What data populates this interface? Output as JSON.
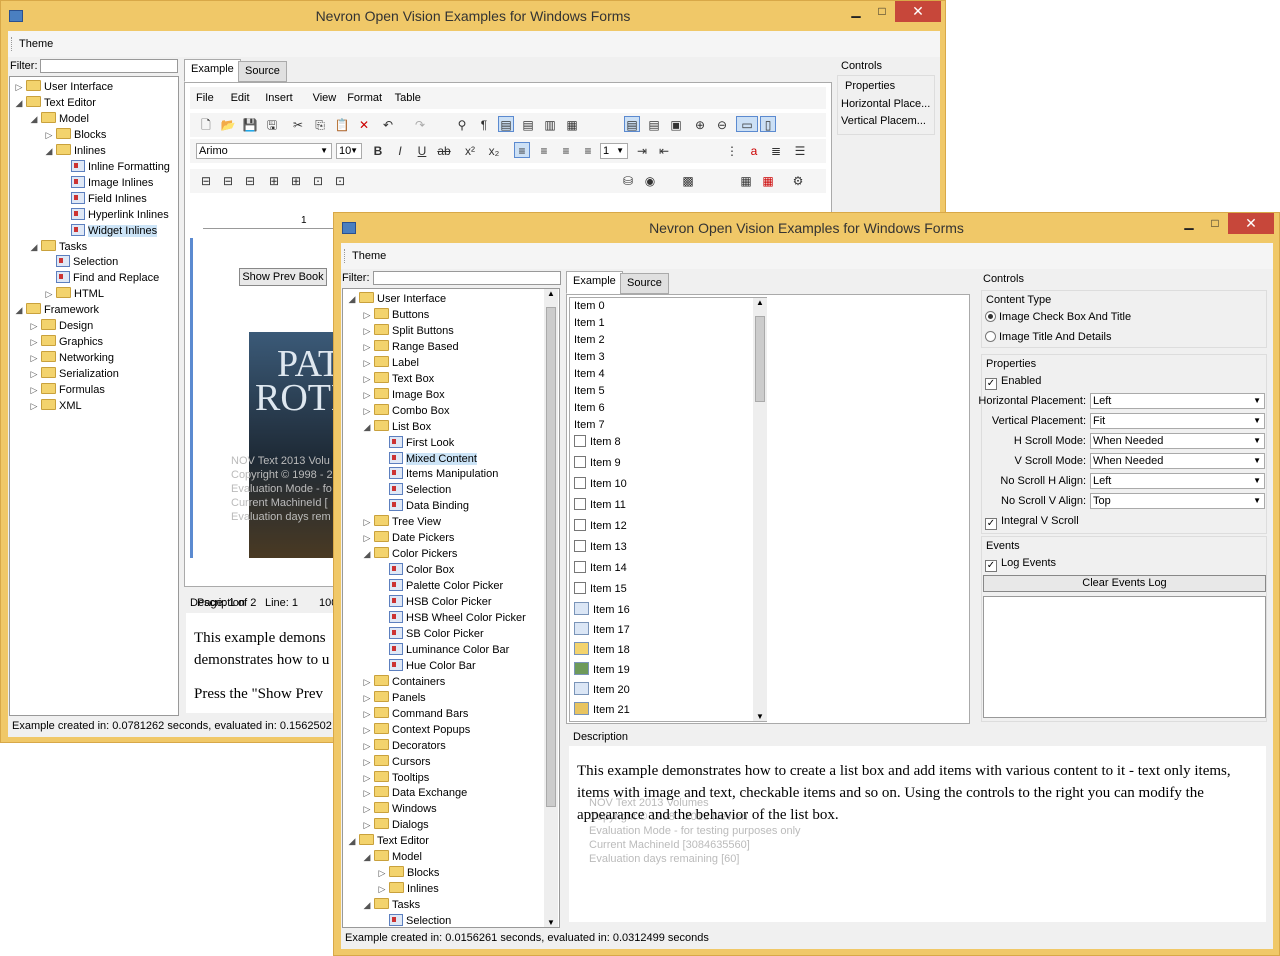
{
  "back": {
    "title": "Nevron Open Vision Examples for Windows Forms",
    "menu": "Theme",
    "filter_label": "Filter:",
    "tree": [
      {
        "t": "User Interface",
        "lvl": 0,
        "tog": "▷",
        "k": "f"
      },
      {
        "t": "Text Editor",
        "lvl": 0,
        "tog": "◢",
        "k": "f"
      },
      {
        "t": "Model",
        "lvl": 1,
        "tog": "◢",
        "k": "f"
      },
      {
        "t": "Blocks",
        "lvl": 2,
        "tog": "▷",
        "k": "f"
      },
      {
        "t": "Inlines",
        "lvl": 2,
        "tog": "◢",
        "k": "f"
      },
      {
        "t": "Inline Formatting",
        "lvl": 3,
        "tog": "",
        "k": "d"
      },
      {
        "t": "Image Inlines",
        "lvl": 3,
        "tog": "",
        "k": "d"
      },
      {
        "t": "Field Inlines",
        "lvl": 3,
        "tog": "",
        "k": "d"
      },
      {
        "t": "Hyperlink Inlines",
        "lvl": 3,
        "tog": "",
        "k": "d"
      },
      {
        "t": "Widget Inlines",
        "lvl": 3,
        "tog": "",
        "k": "d",
        "sel": true
      },
      {
        "t": "Tasks",
        "lvl": 1,
        "tog": "◢",
        "k": "f"
      },
      {
        "t": "Selection",
        "lvl": 2,
        "tog": "",
        "k": "d"
      },
      {
        "t": "Find and Replace",
        "lvl": 2,
        "tog": "",
        "k": "d"
      },
      {
        "t": "HTML",
        "lvl": 2,
        "tog": "▷",
        "k": "f"
      },
      {
        "t": "Framework",
        "lvl": 0,
        "tog": "◢",
        "k": "f"
      },
      {
        "t": "Design",
        "lvl": 1,
        "tog": "▷",
        "k": "f"
      },
      {
        "t": "Graphics",
        "lvl": 1,
        "tog": "▷",
        "k": "f"
      },
      {
        "t": "Networking",
        "lvl": 1,
        "tog": "▷",
        "k": "f"
      },
      {
        "t": "Serialization",
        "lvl": 1,
        "tog": "▷",
        "k": "f"
      },
      {
        "t": "Formulas",
        "lvl": 1,
        "tog": "▷",
        "k": "f"
      },
      {
        "t": "XML",
        "lvl": 1,
        "tog": "▷",
        "k": "f"
      }
    ],
    "tab_example": "Example",
    "tab_source": "Source",
    "editor_menu": [
      "File",
      "Edit",
      "Insert",
      "View",
      "Format",
      "Table"
    ],
    "font_name": "Arimo",
    "font_size": "10",
    "line_spacing": "1",
    "ruler_mark": "1",
    "show_prev_book": "Show Prev Book",
    "page_status": "Page: 1 of 2",
    "line_status": "Line: 1",
    "zoom_status": "100",
    "book_text_1": "PAT",
    "book_text_2": "ROTH",
    "watermark": [
      "NOV Text 2013 Volu",
      "Copyright © 1998 - 2",
      "Evaluation Mode - fo",
      "Current MachineId [",
      "Evaluation days rem"
    ],
    "description_label": "Description",
    "description_1": "This example demons",
    "description_2": "demonstrates how to u",
    "description_3": "Press the \"Show Prev",
    "controls_label": "Controls",
    "properties_label": "Properties",
    "prop_items": [
      "Horizontal Place...",
      "Vertical Placem..."
    ],
    "status": "Example created in: 0.0781262 seconds,  evaluated in: 0.1562502"
  },
  "front": {
    "title": "Nevron Open Vision Examples for Windows Forms",
    "menu": "Theme",
    "filter_label": "Filter:",
    "tree": [
      {
        "t": "User Interface",
        "lvl": 0,
        "tog": "◢",
        "k": "f"
      },
      {
        "t": "Buttons",
        "lvl": 1,
        "tog": "▷",
        "k": "f"
      },
      {
        "t": "Split Buttons",
        "lvl": 1,
        "tog": "▷",
        "k": "f"
      },
      {
        "t": "Range Based",
        "lvl": 1,
        "tog": "▷",
        "k": "f"
      },
      {
        "t": "Label",
        "lvl": 1,
        "tog": "▷",
        "k": "f"
      },
      {
        "t": "Text Box",
        "lvl": 1,
        "tog": "▷",
        "k": "f"
      },
      {
        "t": "Image Box",
        "lvl": 1,
        "tog": "▷",
        "k": "f"
      },
      {
        "t": "Combo Box",
        "lvl": 1,
        "tog": "▷",
        "k": "f"
      },
      {
        "t": "List Box",
        "lvl": 1,
        "tog": "◢",
        "k": "f"
      },
      {
        "t": "First Look",
        "lvl": 2,
        "tog": "",
        "k": "d"
      },
      {
        "t": "Mixed Content",
        "lvl": 2,
        "tog": "",
        "k": "d",
        "sel": true
      },
      {
        "t": "Items Manipulation",
        "lvl": 2,
        "tog": "",
        "k": "d"
      },
      {
        "t": "Selection",
        "lvl": 2,
        "tog": "",
        "k": "d"
      },
      {
        "t": "Data Binding",
        "lvl": 2,
        "tog": "",
        "k": "d"
      },
      {
        "t": "Tree View",
        "lvl": 1,
        "tog": "▷",
        "k": "f"
      },
      {
        "t": "Date Pickers",
        "lvl": 1,
        "tog": "▷",
        "k": "f"
      },
      {
        "t": "Color Pickers",
        "lvl": 1,
        "tog": "◢",
        "k": "f"
      },
      {
        "t": "Color Box",
        "lvl": 2,
        "tog": "",
        "k": "d"
      },
      {
        "t": "Palette Color Picker",
        "lvl": 2,
        "tog": "",
        "k": "d"
      },
      {
        "t": "HSB Color Picker",
        "lvl": 2,
        "tog": "",
        "k": "d"
      },
      {
        "t": "HSB Wheel Color Picker",
        "lvl": 2,
        "tog": "",
        "k": "d"
      },
      {
        "t": "SB Color Picker",
        "lvl": 2,
        "tog": "",
        "k": "d"
      },
      {
        "t": "Luminance Color Bar",
        "lvl": 2,
        "tog": "",
        "k": "d"
      },
      {
        "t": "Hue Color Bar",
        "lvl": 2,
        "tog": "",
        "k": "d"
      },
      {
        "t": "Containers",
        "lvl": 1,
        "tog": "▷",
        "k": "f"
      },
      {
        "t": "Panels",
        "lvl": 1,
        "tog": "▷",
        "k": "f"
      },
      {
        "t": "Command Bars",
        "lvl": 1,
        "tog": "▷",
        "k": "f"
      },
      {
        "t": "Context Popups",
        "lvl": 1,
        "tog": "▷",
        "k": "f"
      },
      {
        "t": "Decorators",
        "lvl": 1,
        "tog": "▷",
        "k": "f"
      },
      {
        "t": "Cursors",
        "lvl": 1,
        "tog": "▷",
        "k": "f"
      },
      {
        "t": "Tooltips",
        "lvl": 1,
        "tog": "▷",
        "k": "f"
      },
      {
        "t": "Data Exchange",
        "lvl": 1,
        "tog": "▷",
        "k": "f"
      },
      {
        "t": "Windows",
        "lvl": 1,
        "tog": "▷",
        "k": "f"
      },
      {
        "t": "Dialogs",
        "lvl": 1,
        "tog": "▷",
        "k": "f"
      },
      {
        "t": "Text Editor",
        "lvl": 0,
        "tog": "◢",
        "k": "f"
      },
      {
        "t": "Model",
        "lvl": 1,
        "tog": "◢",
        "k": "f"
      },
      {
        "t": "Blocks",
        "lvl": 2,
        "tog": "▷",
        "k": "f"
      },
      {
        "t": "Inlines",
        "lvl": 2,
        "tog": "▷",
        "k": "f"
      },
      {
        "t": "Tasks",
        "lvl": 1,
        "tog": "◢",
        "k": "f"
      },
      {
        "t": "Selection",
        "lvl": 2,
        "tog": "",
        "k": "d"
      }
    ],
    "tab_example": "Example",
    "tab_source": "Source",
    "list_items": [
      {
        "t": "Item 0",
        "k": "text"
      },
      {
        "t": "Item 1",
        "k": "text"
      },
      {
        "t": "Item 2",
        "k": "text"
      },
      {
        "t": "Item 3",
        "k": "text"
      },
      {
        "t": "Item 4",
        "k": "text"
      },
      {
        "t": "Item 5",
        "k": "text"
      },
      {
        "t": "Item 6",
        "k": "text"
      },
      {
        "t": "Item 7",
        "k": "text"
      },
      {
        "t": "Item 8",
        "k": "check"
      },
      {
        "t": "Item 9",
        "k": "check"
      },
      {
        "t": "Item 10",
        "k": "check"
      },
      {
        "t": "Item 11",
        "k": "check"
      },
      {
        "t": "Item 12",
        "k": "check"
      },
      {
        "t": "Item 13",
        "k": "check"
      },
      {
        "t": "Item 14",
        "k": "check"
      },
      {
        "t": "Item 15",
        "k": "check"
      },
      {
        "t": "Item 16",
        "k": "image",
        "icon": "calendar-icon"
      },
      {
        "t": "Item 17",
        "k": "image",
        "icon": "document-icon"
      },
      {
        "t": "Item 18",
        "k": "image",
        "icon": "folder-icon"
      },
      {
        "t": "Item 19",
        "k": "image",
        "icon": "image-icon"
      },
      {
        "t": "Item 20",
        "k": "image",
        "icon": "mail-icon"
      },
      {
        "t": "Item 21",
        "k": "image",
        "icon": "note-icon"
      }
    ],
    "controls_label": "Controls",
    "content_type_label": "Content Type",
    "radio_1": "Image Check Box And Title",
    "radio_2": "Image Title And Details",
    "properties_label": "Properties",
    "enabled_label": "Enabled",
    "props": [
      {
        "label": "Horizontal Placement:",
        "value": "Left"
      },
      {
        "label": "Vertical Placement:",
        "value": "Fit"
      },
      {
        "label": "H Scroll Mode:",
        "value": "When Needed"
      },
      {
        "label": "V Scroll Mode:",
        "value": "When Needed"
      },
      {
        "label": "No Scroll H Align:",
        "value": "Left"
      },
      {
        "label": "No Scroll V Align:",
        "value": "Top"
      }
    ],
    "integral_label": "Integral V Scroll",
    "events_label": "Events",
    "log_events_label": "Log Events",
    "clear_log": "Clear Events Log",
    "description_label": "Description",
    "description": "This example demonstrates how to create a list box and add items with various content to it - text only items, items with image and text, checkable items and so on. Using the controls to the right you can modify the appearance and the behavior of the list box.",
    "watermark": [
      "NOV Text 2013 Volumes",
      "Copyright © 1998 - 2013 Nevron",
      "Evaluation Mode - for testing purposes only",
      "Current MachineId [3084635560]",
      "Evaluation days remaining [60]"
    ],
    "status": "Example created in: 0.0156261 seconds,  evaluated in: 0.0312499 seconds"
  },
  "window_buttons": {
    "min": "▁",
    "max": "□",
    "close": "✕"
  }
}
